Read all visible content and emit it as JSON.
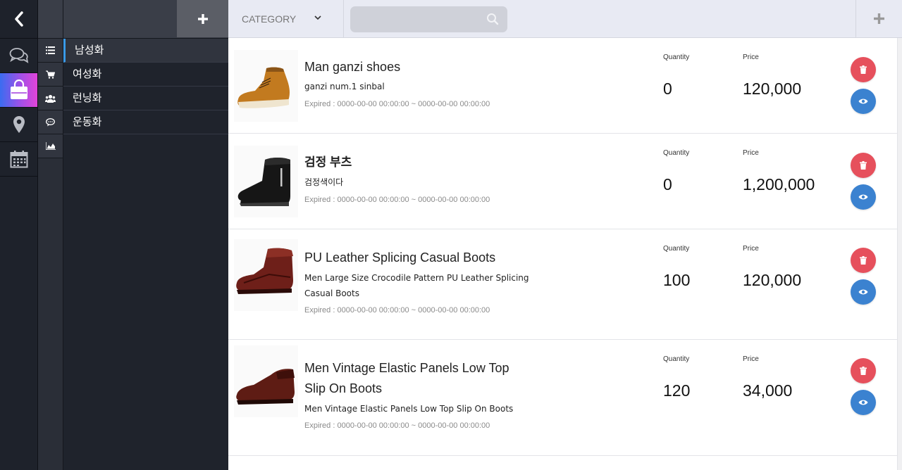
{
  "icons": {
    "back": "chevron-left-icon",
    "rail": [
      "chat-icon",
      "shopping-bag-icon",
      "map-pin-icon",
      "calendar-icon"
    ],
    "mini": [
      "list-icon",
      "cart-icon",
      "users-icon",
      "comment-icon",
      "area-chart-icon"
    ]
  },
  "category_panel": {
    "items": [
      "남성화",
      "여성화",
      "런닝화",
      "운동화"
    ]
  },
  "topbar": {
    "category_label": "CATEGORY",
    "search_placeholder": ""
  },
  "products": [
    {
      "name": "Man ganzi shoes",
      "description": "ganzi num.1 sinbal",
      "expired": "Expired : 0000-00-00 00:00:00 ~ 0000-00-00 00:00:00",
      "quantity_label": "Quantity",
      "quantity": "0",
      "price_label": "Price",
      "price": "120,000"
    },
    {
      "name": "검정 부츠",
      "description": "검정색이다",
      "expired": "Expired : 0000-00-00 00:00:00 ~ 0000-00-00 00:00:00",
      "quantity_label": "Quantity",
      "quantity": "0",
      "price_label": "Price",
      "price": "1,200,000"
    },
    {
      "name": "PU Leather Splicing Casual Boots",
      "description": "Men Large Size Crocodile Pattern PU Leather Splicing Casual Boots",
      "expired": "Expired : 0000-00-00 00:00:00 ~ 0000-00-00 00:00:00",
      "quantity_label": "Quantity",
      "quantity": "100",
      "price_label": "Price",
      "price": "120,000"
    },
    {
      "name": "Men Vintage Elastic Panels Low Top Slip On Boots",
      "description": "Men Vintage Elastic Panels Low Top Slip On Boots",
      "expired": "Expired : 0000-00-00 00:00:00 ~ 0000-00-00 00:00:00",
      "quantity_label": "Quantity",
      "quantity": "120",
      "price_label": "Price",
      "price": "34,000"
    }
  ],
  "colors": {
    "delete": "#e6505c",
    "view": "#3b82d0",
    "accent": "#3a9ae8"
  }
}
